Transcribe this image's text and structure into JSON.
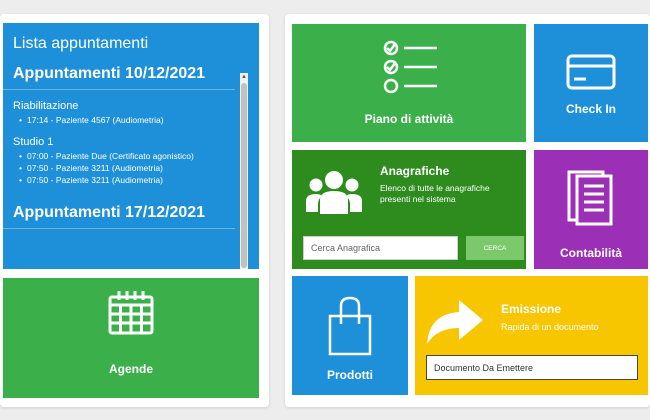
{
  "colors": {
    "blue": "#1e90d9",
    "green": "#3bb04a",
    "dark_green": "#2e8b1e",
    "purple": "#9b2fb5",
    "yellow": "#f7c600",
    "cerca_green": "#7cc96b"
  },
  "appointments": {
    "title": "Lista appuntamenti",
    "days": [
      {
        "heading": "Appuntamenti 10/12/2021",
        "sections": [
          {
            "name": "Riabilitazione",
            "items": [
              "17:14 - Paziente 4567 (Audiometria)"
            ]
          },
          {
            "name": "Studio 1",
            "items": [
              "07:00 - Paziente Due (Certificato agonistico)",
              "07:50 - Paziente 3211 (Audiometria)",
              "07:50 - Paziente 3211 (Audiometria)"
            ]
          }
        ]
      },
      {
        "heading": "Appuntamenti 17/12/2021"
      }
    ]
  },
  "tiles": {
    "agende": {
      "label": "Agende",
      "icon": "calendar-icon"
    },
    "piano": {
      "label": "Piano di attività",
      "icon": "checklist-icon"
    },
    "checkin": {
      "label": "Check In",
      "icon": "credit-card-icon"
    },
    "anagrafiche": {
      "title": "Anagrafiche",
      "description": "Elenco di tutte le anagrafiche presenti nel sistema",
      "search_placeholder": "Cerca Anagrafica",
      "search_button": "CERCA",
      "icon": "users-icon"
    },
    "contabilita": {
      "label": "Contabilità",
      "icon": "document-icon"
    },
    "prodotti": {
      "label": "Prodotti",
      "icon": "shopping-bag-icon"
    },
    "emissione": {
      "title": "Emissione",
      "description": "Rapida di un documento",
      "input_placeholder": "Documento Da Emettere",
      "icon": "share-arrow-icon"
    }
  }
}
